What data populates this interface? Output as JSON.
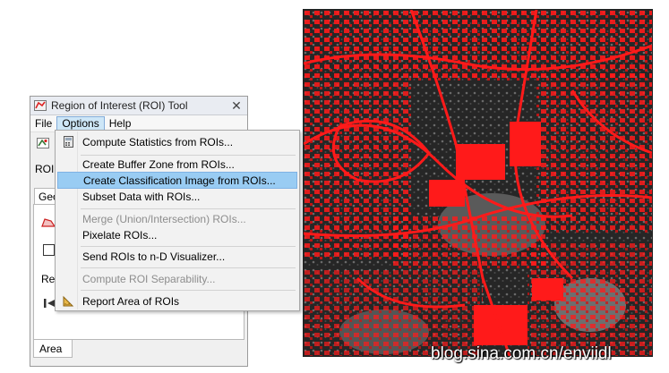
{
  "window": {
    "title": "Region of Interest (ROI) Tool",
    "close": "✕",
    "menus": [
      "File",
      "Options",
      "Help"
    ],
    "roi_label": "ROI",
    "geometry_tab": "Geometry",
    "record_label": "Rec",
    "area_tab": "Area"
  },
  "options_menu": {
    "items": [
      {
        "label": "Compute Statistics from ROIs...",
        "enabled": true
      },
      {
        "label": "Create Buffer Zone from ROIs...",
        "enabled": true
      },
      {
        "label": "Create Classification Image from ROIs...",
        "enabled": true,
        "highlighted": true
      },
      {
        "label": "Subset Data with ROIs...",
        "enabled": true
      },
      {
        "label": "Merge (Union/Intersection) ROIs...",
        "enabled": false
      },
      {
        "label": "Pixelate ROIs...",
        "enabled": true
      },
      {
        "label": "Send ROIs to n-D Visualizer...",
        "enabled": true
      },
      {
        "label": "Compute ROI Separability...",
        "enabled": false
      },
      {
        "label": "Report Area of ROIs",
        "enabled": true
      }
    ]
  },
  "image": {
    "description_colors": {
      "roi": "#ff1a1a",
      "background": "#1c1c1c"
    }
  },
  "watermark": "blog.sina.com.cn/enviidl",
  "colors": {
    "highlight": "#99ccf3",
    "menu_active": "#cde6f7"
  }
}
